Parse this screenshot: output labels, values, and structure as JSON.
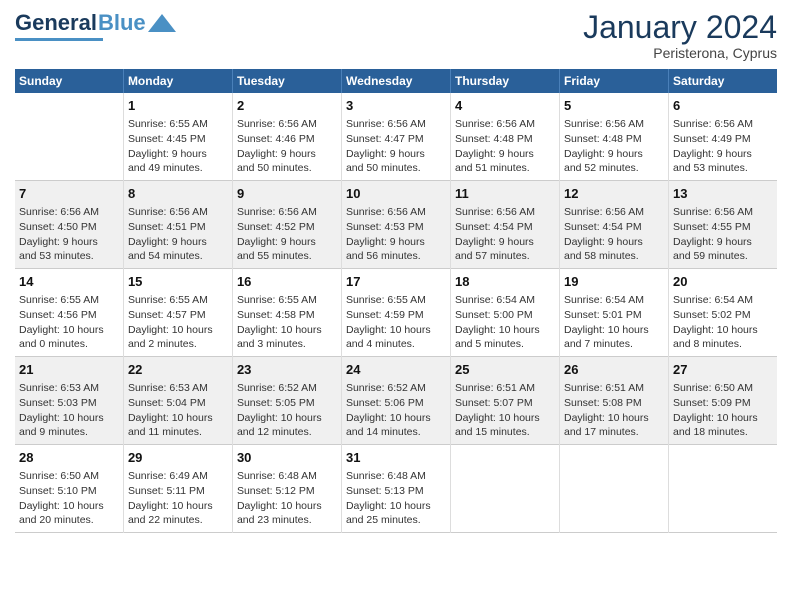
{
  "header": {
    "logo_general": "General",
    "logo_blue": "Blue",
    "month_title": "January 2024",
    "subtitle": "Peristerona, Cyprus"
  },
  "days_of_week": [
    "Sunday",
    "Monday",
    "Tuesday",
    "Wednesday",
    "Thursday",
    "Friday",
    "Saturday"
  ],
  "weeks": [
    [
      {
        "day": "",
        "info": ""
      },
      {
        "day": "1",
        "info": "Sunrise: 6:55 AM\nSunset: 4:45 PM\nDaylight: 9 hours\nand 49 minutes."
      },
      {
        "day": "2",
        "info": "Sunrise: 6:56 AM\nSunset: 4:46 PM\nDaylight: 9 hours\nand 50 minutes."
      },
      {
        "day": "3",
        "info": "Sunrise: 6:56 AM\nSunset: 4:47 PM\nDaylight: 9 hours\nand 50 minutes."
      },
      {
        "day": "4",
        "info": "Sunrise: 6:56 AM\nSunset: 4:48 PM\nDaylight: 9 hours\nand 51 minutes."
      },
      {
        "day": "5",
        "info": "Sunrise: 6:56 AM\nSunset: 4:48 PM\nDaylight: 9 hours\nand 52 minutes."
      },
      {
        "day": "6",
        "info": "Sunrise: 6:56 AM\nSunset: 4:49 PM\nDaylight: 9 hours\nand 53 minutes."
      }
    ],
    [
      {
        "day": "7",
        "info": "Sunrise: 6:56 AM\nSunset: 4:50 PM\nDaylight: 9 hours\nand 53 minutes."
      },
      {
        "day": "8",
        "info": "Sunrise: 6:56 AM\nSunset: 4:51 PM\nDaylight: 9 hours\nand 54 minutes."
      },
      {
        "day": "9",
        "info": "Sunrise: 6:56 AM\nSunset: 4:52 PM\nDaylight: 9 hours\nand 55 minutes."
      },
      {
        "day": "10",
        "info": "Sunrise: 6:56 AM\nSunset: 4:53 PM\nDaylight: 9 hours\nand 56 minutes."
      },
      {
        "day": "11",
        "info": "Sunrise: 6:56 AM\nSunset: 4:54 PM\nDaylight: 9 hours\nand 57 minutes."
      },
      {
        "day": "12",
        "info": "Sunrise: 6:56 AM\nSunset: 4:54 PM\nDaylight: 9 hours\nand 58 minutes."
      },
      {
        "day": "13",
        "info": "Sunrise: 6:56 AM\nSunset: 4:55 PM\nDaylight: 9 hours\nand 59 minutes."
      }
    ],
    [
      {
        "day": "14",
        "info": "Sunrise: 6:55 AM\nSunset: 4:56 PM\nDaylight: 10 hours\nand 0 minutes."
      },
      {
        "day": "15",
        "info": "Sunrise: 6:55 AM\nSunset: 4:57 PM\nDaylight: 10 hours\nand 2 minutes."
      },
      {
        "day": "16",
        "info": "Sunrise: 6:55 AM\nSunset: 4:58 PM\nDaylight: 10 hours\nand 3 minutes."
      },
      {
        "day": "17",
        "info": "Sunrise: 6:55 AM\nSunset: 4:59 PM\nDaylight: 10 hours\nand 4 minutes."
      },
      {
        "day": "18",
        "info": "Sunrise: 6:54 AM\nSunset: 5:00 PM\nDaylight: 10 hours\nand 5 minutes."
      },
      {
        "day": "19",
        "info": "Sunrise: 6:54 AM\nSunset: 5:01 PM\nDaylight: 10 hours\nand 7 minutes."
      },
      {
        "day": "20",
        "info": "Sunrise: 6:54 AM\nSunset: 5:02 PM\nDaylight: 10 hours\nand 8 minutes."
      }
    ],
    [
      {
        "day": "21",
        "info": "Sunrise: 6:53 AM\nSunset: 5:03 PM\nDaylight: 10 hours\nand 9 minutes."
      },
      {
        "day": "22",
        "info": "Sunrise: 6:53 AM\nSunset: 5:04 PM\nDaylight: 10 hours\nand 11 minutes."
      },
      {
        "day": "23",
        "info": "Sunrise: 6:52 AM\nSunset: 5:05 PM\nDaylight: 10 hours\nand 12 minutes."
      },
      {
        "day": "24",
        "info": "Sunrise: 6:52 AM\nSunset: 5:06 PM\nDaylight: 10 hours\nand 14 minutes."
      },
      {
        "day": "25",
        "info": "Sunrise: 6:51 AM\nSunset: 5:07 PM\nDaylight: 10 hours\nand 15 minutes."
      },
      {
        "day": "26",
        "info": "Sunrise: 6:51 AM\nSunset: 5:08 PM\nDaylight: 10 hours\nand 17 minutes."
      },
      {
        "day": "27",
        "info": "Sunrise: 6:50 AM\nSunset: 5:09 PM\nDaylight: 10 hours\nand 18 minutes."
      }
    ],
    [
      {
        "day": "28",
        "info": "Sunrise: 6:50 AM\nSunset: 5:10 PM\nDaylight: 10 hours\nand 20 minutes."
      },
      {
        "day": "29",
        "info": "Sunrise: 6:49 AM\nSunset: 5:11 PM\nDaylight: 10 hours\nand 22 minutes."
      },
      {
        "day": "30",
        "info": "Sunrise: 6:48 AM\nSunset: 5:12 PM\nDaylight: 10 hours\nand 23 minutes."
      },
      {
        "day": "31",
        "info": "Sunrise: 6:48 AM\nSunset: 5:13 PM\nDaylight: 10 hours\nand 25 minutes."
      },
      {
        "day": "",
        "info": ""
      },
      {
        "day": "",
        "info": ""
      },
      {
        "day": "",
        "info": ""
      }
    ]
  ]
}
